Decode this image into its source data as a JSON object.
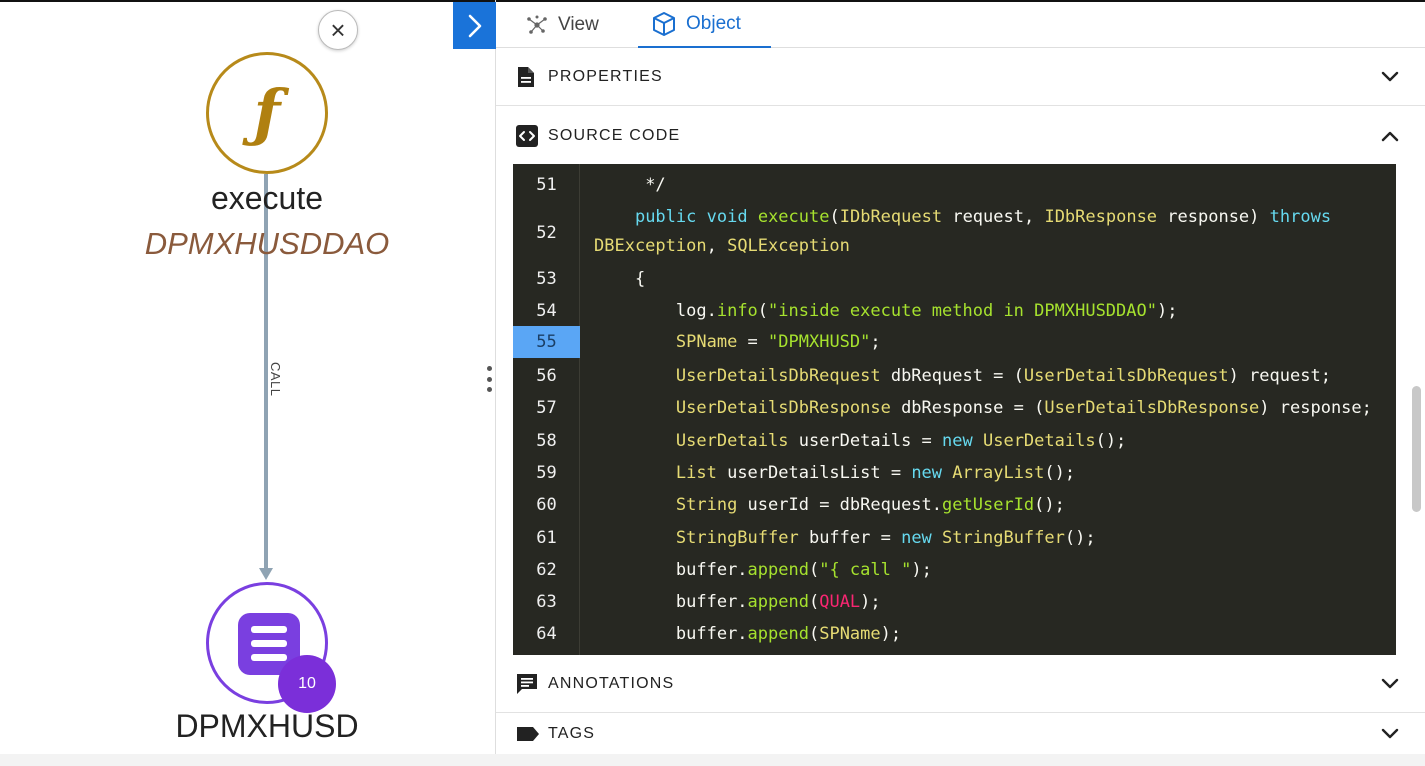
{
  "graph": {
    "close_symbol": "×",
    "source_node": {
      "icon": "function-icon",
      "glyph": "ƒ",
      "title": "execute",
      "subtitle": "DPMXHUSDDAO",
      "color": "#b78a1a"
    },
    "edge_label": "CALL",
    "target_node": {
      "icon": "table-icon",
      "title": "DPMXHUSD",
      "badge": "10",
      "color": "#7a3fe0"
    }
  },
  "tabs": [
    {
      "label": "View",
      "icon": "view-network-icon",
      "active": false
    },
    {
      "label": "Object",
      "icon": "cube-icon",
      "active": true
    }
  ],
  "sections": {
    "properties": {
      "title": "PROPERTIES",
      "icon": "document-icon",
      "expanded": false
    },
    "source_code": {
      "title": "SOURCE CODE",
      "icon": "code-icon",
      "expanded": true
    },
    "annotations": {
      "title": "ANNOTATIONS",
      "icon": "comment-icon",
      "expanded": false
    },
    "tags": {
      "title": "TAGS",
      "icon": "tag-icon",
      "expanded": false
    }
  },
  "code": {
    "highlighted_line": "55",
    "lines": [
      {
        "n": "51",
        "indent": "     ",
        "parts": [
          {
            "t": "*/",
            "c": "id"
          }
        ]
      },
      {
        "n": "52",
        "indent": "    ",
        "parts": [
          {
            "t": "public",
            "c": "kw"
          },
          {
            "t": " ",
            "c": "id"
          },
          {
            "t": "void",
            "c": "kw"
          },
          {
            "t": " ",
            "c": "id"
          },
          {
            "t": "execute",
            "c": "fn"
          },
          {
            "t": "(",
            "c": "id"
          },
          {
            "t": "IDbRequest",
            "c": "ty"
          },
          {
            "t": " request, ",
            "c": "id"
          },
          {
            "t": "IDbResponse",
            "c": "ty"
          },
          {
            "t": " response) ",
            "c": "id"
          },
          {
            "t": "throws",
            "c": "kw"
          },
          {
            "t": " ",
            "c": "id"
          },
          {
            "t": "DBException",
            "c": "ty"
          },
          {
            "t": ", ",
            "c": "id"
          },
          {
            "t": "SQLException",
            "c": "ty"
          }
        ]
      },
      {
        "n": "53",
        "indent": "    ",
        "parts": [
          {
            "t": "{",
            "c": "id"
          }
        ]
      },
      {
        "n": "54",
        "indent": "        ",
        "parts": [
          {
            "t": "log.",
            "c": "id"
          },
          {
            "t": "info",
            "c": "fn"
          },
          {
            "t": "(",
            "c": "id"
          },
          {
            "t": "\"inside execute method in DPMXHUSDDAO\"",
            "c": "str"
          },
          {
            "t": ");",
            "c": "id"
          }
        ]
      },
      {
        "n": "55",
        "indent": "        ",
        "parts": [
          {
            "t": "SPName",
            "c": "ty"
          },
          {
            "t": " = ",
            "c": "id"
          },
          {
            "t": "\"DPMXHUSD\"",
            "c": "str"
          },
          {
            "t": ";",
            "c": "id"
          }
        ]
      },
      {
        "n": "56",
        "indent": "        ",
        "parts": [
          {
            "t": "UserDetailsDbRequest",
            "c": "ty"
          },
          {
            "t": " dbRequest = (",
            "c": "id"
          },
          {
            "t": "UserDetailsDbRequest",
            "c": "ty"
          },
          {
            "t": ") request;",
            "c": "id"
          }
        ]
      },
      {
        "n": "57",
        "indent": "        ",
        "parts": [
          {
            "t": "UserDetailsDbResponse",
            "c": "ty"
          },
          {
            "t": " dbResponse = (",
            "c": "id"
          },
          {
            "t": "UserDetailsDbResponse",
            "c": "ty"
          },
          {
            "t": ") response;",
            "c": "id"
          }
        ]
      },
      {
        "n": "58",
        "indent": "        ",
        "parts": [
          {
            "t": "UserDetails",
            "c": "ty"
          },
          {
            "t": " userDetails = ",
            "c": "id"
          },
          {
            "t": "new",
            "c": "kw"
          },
          {
            "t": " ",
            "c": "id"
          },
          {
            "t": "UserDetails",
            "c": "ty"
          },
          {
            "t": "();",
            "c": "id"
          }
        ]
      },
      {
        "n": "59",
        "indent": "        ",
        "parts": [
          {
            "t": "List",
            "c": "ty"
          },
          {
            "t": " userDetailsList = ",
            "c": "id"
          },
          {
            "t": "new",
            "c": "kw"
          },
          {
            "t": " ",
            "c": "id"
          },
          {
            "t": "ArrayList",
            "c": "ty"
          },
          {
            "t": "();",
            "c": "id"
          }
        ]
      },
      {
        "n": "60",
        "indent": "        ",
        "parts": [
          {
            "t": "String",
            "c": "ty"
          },
          {
            "t": " userId = dbRequest.",
            "c": "id"
          },
          {
            "t": "getUserId",
            "c": "fn"
          },
          {
            "t": "();",
            "c": "id"
          }
        ]
      },
      {
        "n": "61",
        "indent": "        ",
        "parts": [
          {
            "t": "StringBuffer",
            "c": "ty"
          },
          {
            "t": " buffer = ",
            "c": "id"
          },
          {
            "t": "new",
            "c": "kw"
          },
          {
            "t": " ",
            "c": "id"
          },
          {
            "t": "StringBuffer",
            "c": "ty"
          },
          {
            "t": "();",
            "c": "id"
          }
        ]
      },
      {
        "n": "62",
        "indent": "        ",
        "parts": [
          {
            "t": "buffer.",
            "c": "id"
          },
          {
            "t": "append",
            "c": "fn"
          },
          {
            "t": "(",
            "c": "id"
          },
          {
            "t": "\"{ call \"",
            "c": "str"
          },
          {
            "t": ");",
            "c": "id"
          }
        ]
      },
      {
        "n": "63",
        "indent": "        ",
        "parts": [
          {
            "t": "buffer.",
            "c": "id"
          },
          {
            "t": "append",
            "c": "fn"
          },
          {
            "t": "(",
            "c": "id"
          },
          {
            "t": "QUAL",
            "c": "ct"
          },
          {
            "t": ");",
            "c": "id"
          }
        ]
      },
      {
        "n": "64",
        "indent": "        ",
        "parts": [
          {
            "t": "buffer.",
            "c": "id"
          },
          {
            "t": "append",
            "c": "fn"
          },
          {
            "t": "(",
            "c": "id"
          },
          {
            "t": "SPName",
            "c": "ty"
          },
          {
            "t": ");",
            "c": "id"
          }
        ]
      }
    ]
  }
}
